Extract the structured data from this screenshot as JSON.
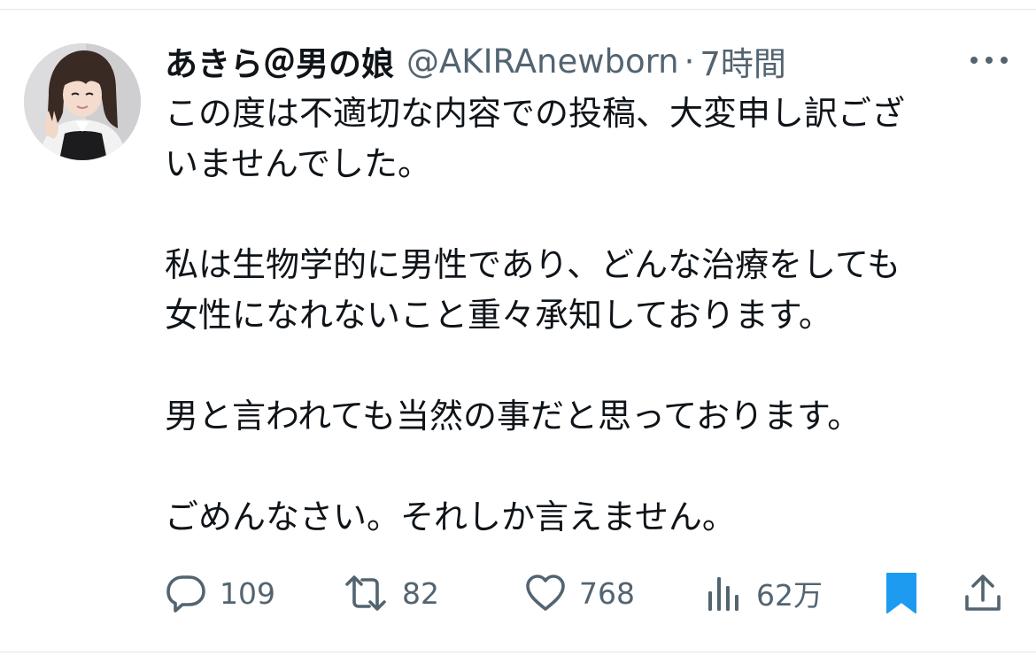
{
  "tweet": {
    "display_name": "あきら＠男の娘",
    "handle": "@AKIRAnewborn",
    "separator": "·",
    "time": "7時間",
    "body": {
      "line1": "この度は不適切な内容での投稿、大変申し訳ござ",
      "line2": "いませんでした。",
      "line3": "私は生物学的に男性であり、どんな治療をしても",
      "line4": "女性になれないこと重々承知しております。",
      "line5": "男と言われても当然の事だと思っております。",
      "line6": "ごめんなさい。それしか言えません。"
    },
    "stats": {
      "replies": "109",
      "retweets": "82",
      "likes": "768",
      "views": "62万"
    }
  },
  "icons": {
    "more": "more-horizontal-icon",
    "reply": "reply-bubble-icon",
    "retweet": "retweet-icon",
    "like": "heart-icon",
    "views": "views-bar-icon",
    "bookmark": "bookmark-icon",
    "share": "share-upload-icon"
  },
  "colors": {
    "text": "#0f1419",
    "secondary": "#536471",
    "bookmark": "#1d9bf0"
  }
}
